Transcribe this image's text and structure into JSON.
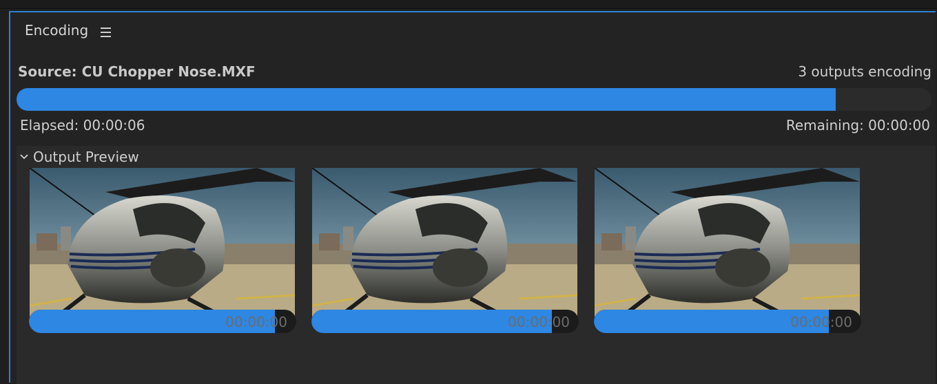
{
  "panel": {
    "title": "Encoding",
    "menu_icon": "hamburger-menu-icon"
  },
  "encoding": {
    "source_label": "Source: CU Chopper Nose.MXF",
    "outputs_label": "3 outputs encoding",
    "progress": 0.895,
    "elapsed_label": "Elapsed: 00:00:06",
    "remaining_label": "Remaining: 00:00:00"
  },
  "preview": {
    "header": "Output Preview",
    "chevron_icon": "chevron-down-icon",
    "items": [
      {
        "time": "00:00:00",
        "progress": 0.92
      },
      {
        "time": "00:00:00",
        "progress": 0.9
      },
      {
        "time": "00:00:00",
        "progress": 0.88
      }
    ]
  },
  "colors": {
    "accent": "#2d87e3",
    "panel_border": "#2d82d6",
    "background": "#232323"
  }
}
